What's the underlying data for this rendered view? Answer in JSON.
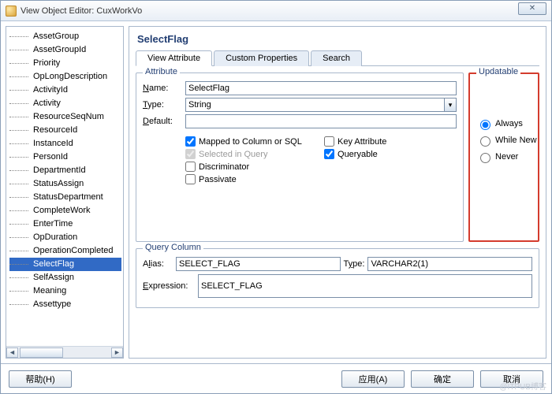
{
  "window": {
    "title": "View Object Editor: CuxWorkVo",
    "closeGlyph": "✕"
  },
  "tree": {
    "items": [
      "AssetGroup",
      "AssetGroupId",
      "Priority",
      "OpLongDescription",
      "ActivityId",
      "Activity",
      "ResourceSeqNum",
      "ResourceId",
      "InstanceId",
      "PersonId",
      "DepartmentId",
      "StatusAssign",
      "StatusDepartment",
      "CompleteWork",
      "EnterTime",
      "OpDuration",
      "OperationCompleted",
      "SelectFlag",
      "SelfAssign",
      "Meaning",
      "Assettype"
    ],
    "selectedIndex": 17
  },
  "panel": {
    "heading": "SelectFlag",
    "tabs": [
      "View Attribute",
      "Custom Properties",
      "Search"
    ],
    "activeTab": 0
  },
  "attribute": {
    "groupTitle": "Attribute",
    "nameLabel": "Name:",
    "nameValue": "SelectFlag",
    "typeLabel": "Type:",
    "typeValue": "String",
    "defaultLabel": "Default:",
    "defaultValue": "",
    "checks": {
      "mapped": {
        "label": "Mapped to Column or SQL",
        "checked": true,
        "disabled": false
      },
      "selectedInQuery": {
        "label": "Selected in Query",
        "checked": true,
        "disabled": true
      },
      "discriminator": {
        "label": "Discriminator",
        "checked": false,
        "disabled": false
      },
      "passivate": {
        "label": "Passivate",
        "checked": false,
        "disabled": false
      },
      "keyAttribute": {
        "label": "Key Attribute",
        "checked": false,
        "disabled": false
      },
      "queryable": {
        "label": "Queryable",
        "checked": true,
        "disabled": false
      }
    }
  },
  "updatable": {
    "groupTitle": "Updatable",
    "options": [
      {
        "label": "Always",
        "checked": true
      },
      {
        "label": "While New",
        "checked": false
      },
      {
        "label": "Never",
        "checked": false
      }
    ]
  },
  "queryColumn": {
    "groupTitle": "Query Column",
    "aliasLabel": "Alias:",
    "aliasValue": "SELECT_FLAG",
    "typeLabel": "Type:",
    "typeValue": "VARCHAR2(1)",
    "exprLabel": "Expression:",
    "exprValue": "SELECT_FLAG"
  },
  "buttons": {
    "help": "帮助(H)",
    "apply": "应用(A)",
    "ok": "确定",
    "cancel": "取消"
  },
  "watermark": "@ITPUB博客",
  "glyphs": {
    "dropdown": "▾",
    "left": "◄",
    "right": "►"
  }
}
